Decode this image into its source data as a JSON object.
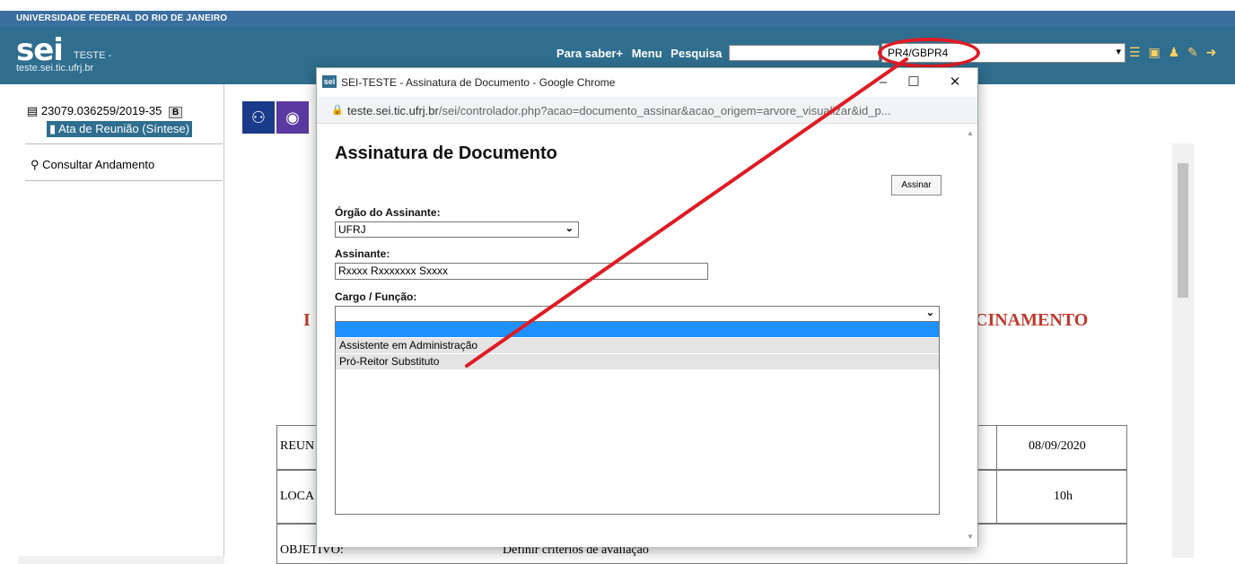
{
  "university_bar": {
    "text": "UNIVERSIDADE FEDERAL DO RIO DE JANEIRO"
  },
  "header": {
    "logo": "sei",
    "env": "TESTE -",
    "url": "teste.sei.tic.ufrj.br",
    "nav": {
      "saber": "Para saber+",
      "menu": "Menu",
      "pesquisa": "Pesquisa"
    },
    "unit": "PR4/GBPR4",
    "icons": [
      "list-icon",
      "notes-icon",
      "user-icon",
      "wrench-icon",
      "exit-icon"
    ]
  },
  "tree": {
    "process_number": "23079.036259/2019-35",
    "process_badge": "B",
    "document": "Ata de Reunião (Síntese)",
    "consult": "Consultar Andamento"
  },
  "background_doc": {
    "title_left": "I",
    "title_right": "CINAMENTO",
    "rows": [
      {
        "left": "REUN",
        "right": "08/09/2020"
      },
      {
        "left": "LOCA",
        "right": "10h"
      },
      {
        "left": "OBJETIVO:",
        "mid": "Definir critérios de avaliação"
      }
    ]
  },
  "popup": {
    "window_title": "SEI-TESTE - Assinatura de Documento - Google Chrome",
    "favicon": "sei",
    "url_host": "teste.sei.tic.ufrj.br",
    "url_path": "/sei/controlador.php?acao=documento_assinar&acao_origem=arvore_visualizar&id_p...",
    "form_title": "Assinatura de Documento",
    "assinar_label": "Assinar",
    "orgao_label": "Órgão do Assinante:",
    "orgao_value": "UFRJ",
    "assinante_label": "Assinante:",
    "assinante_value": "Rxxxx Rxxxxxxx Sxxxx",
    "cargo_label": "Cargo / Função:",
    "cargo_options": [
      "",
      "Assistente em Administração",
      "Pró-Reitor Substituto"
    ]
  },
  "colors": {
    "header_bg": "#2f6e8f",
    "annotation": "#e01b24",
    "highlight": "#1e90ff"
  }
}
